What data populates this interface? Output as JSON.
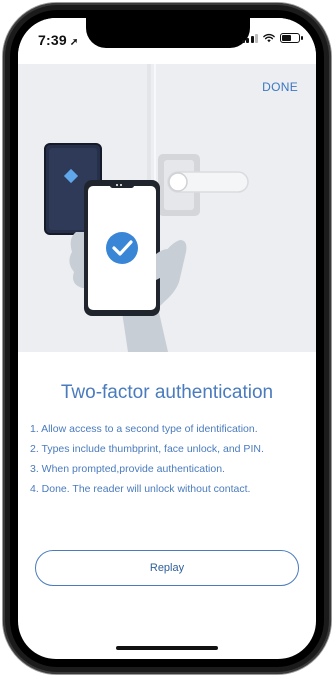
{
  "status_bar": {
    "time": "7:39",
    "location_glyph": "➚"
  },
  "header": {
    "done_label": "DONE"
  },
  "main": {
    "title": "Two-factor authentication",
    "steps": [
      "1. Allow access to a second type of identification.",
      "2. Types include thumbprint, face unlock, and PIN.",
      "3. When prompted,provide authentication.",
      "4. Done. The reader will unlock without contact."
    ],
    "replay_label": "Replay"
  },
  "colors": {
    "accent": "#4a7bbd",
    "hero_background": "#eceef1",
    "reader_body": "#27304a",
    "check_circle": "#3a86d6"
  }
}
